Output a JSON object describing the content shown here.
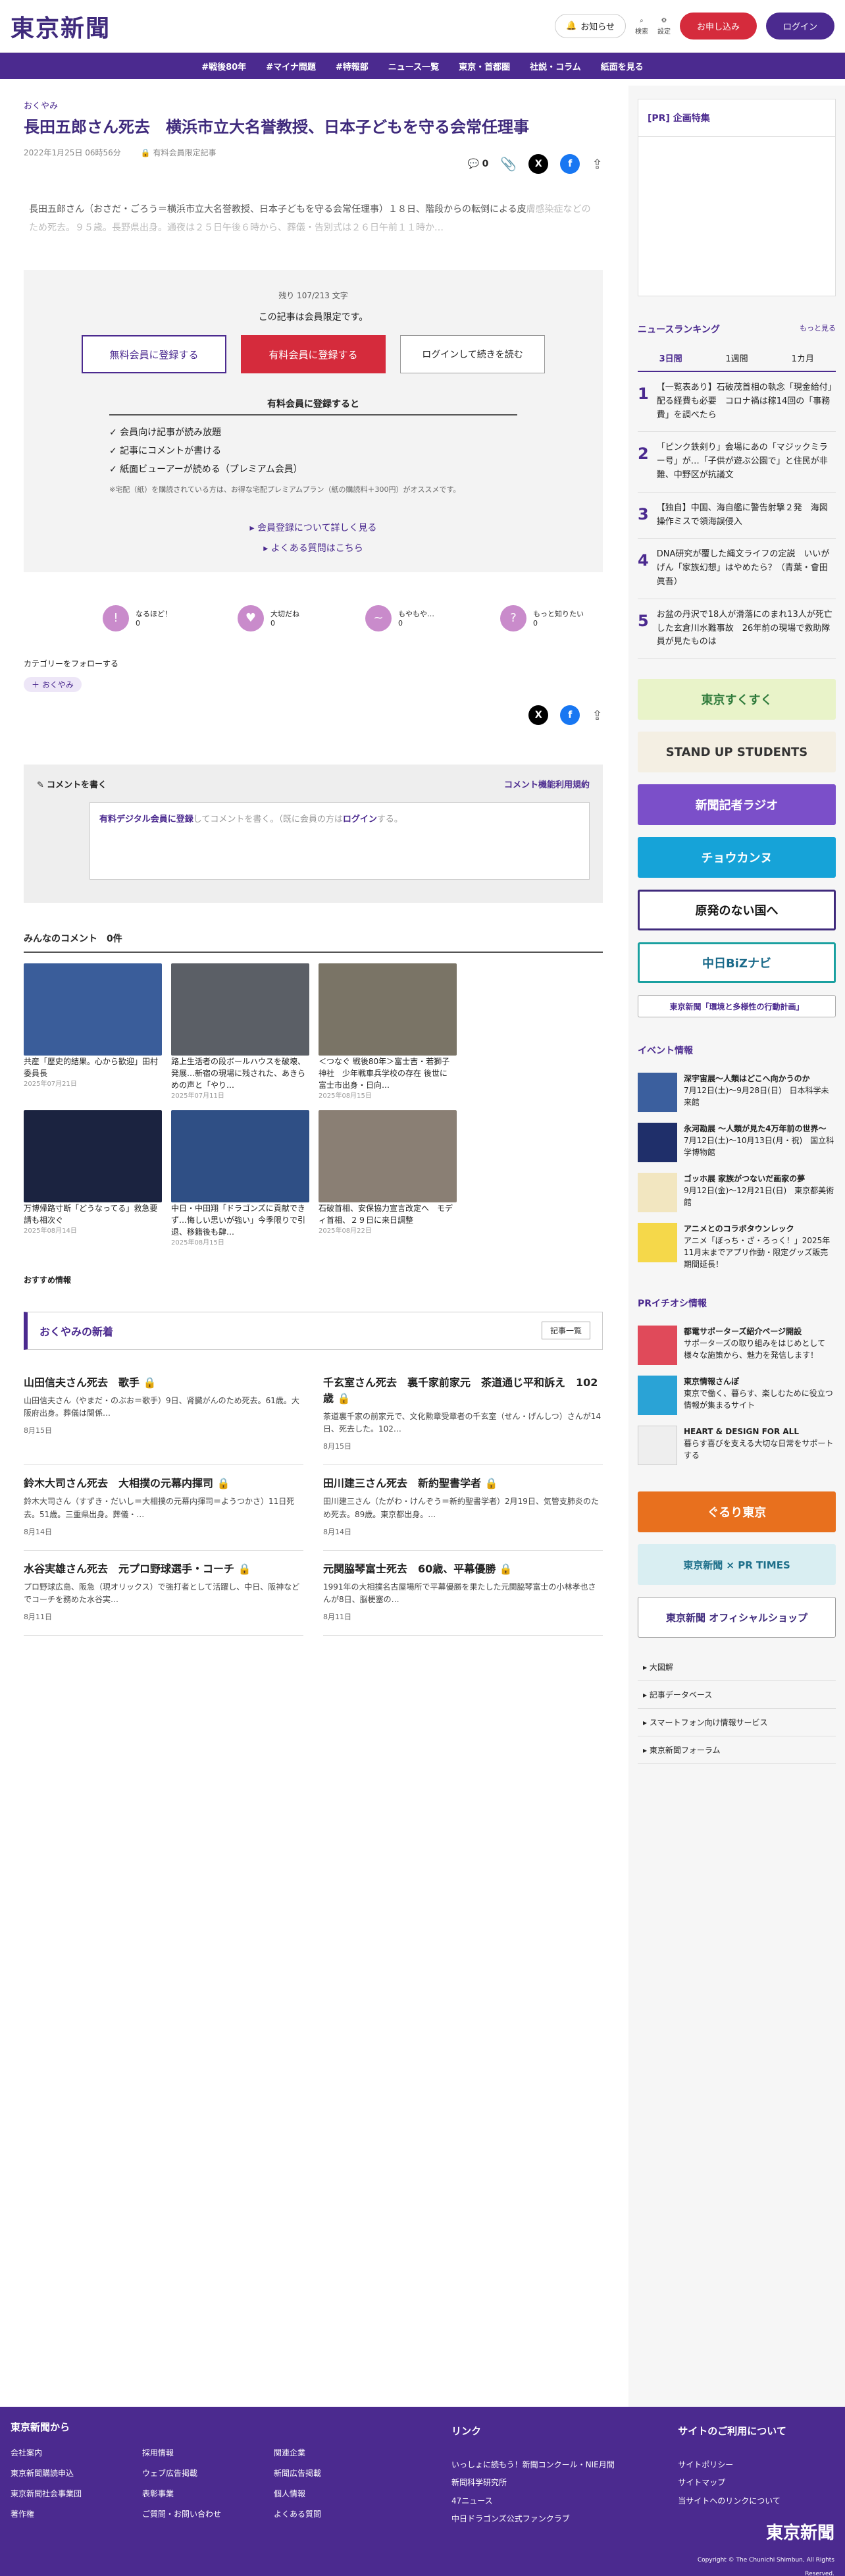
{
  "header": {
    "logo": "東京新聞",
    "notify": "お知らせ",
    "search": "検索",
    "settings": "設定",
    "register": "お申し込み",
    "login": "ログイン"
  },
  "nav": [
    "#戦後80年",
    "#マイナ問題",
    "#特報部",
    "ニュース一覧",
    "東京・首都圏",
    "社説・コラム",
    "紙面を見る"
  ],
  "article": {
    "category": "おくやみ",
    "title": "長田五郎さん死去　横浜市立大名誉教授、日本子どもを守る会常任理事",
    "date": "2022年1月25日 06時56分",
    "member_label": "有料会員限定記事",
    "comment_count": "0",
    "lead": "長田五郎さん（おさだ・ごろう＝横浜市立大名誉教授、日本子どもを守る会常任理事）１８日、階段からの転倒による皮",
    "lead_faded": "膚感染症などのため死去。９５歳。長野県出身。通夜は２５日午後６時から、葬儀・告別式は２６日午前１１時か…"
  },
  "paywall": {
    "remain": "残り 107/213 文字",
    "limited": "この記事は会員限定です。",
    "free_btn": "無料会員に登録する",
    "paid_btn": "有料会員に登録する",
    "login_btn": "ログインして続きを読む",
    "perk_head": "有料会員に登録すると",
    "perks": [
      "✓ 会員向け記事が読み放題",
      "✓ 記事にコメントが書ける",
      "✓ 紙面ビューアーが読める（プレミアム会員）"
    ],
    "note": "※宅配（紙）を購読されている方は、お得な宅配プレミアムプラン（紙の購読料＋300円）がオススメです。",
    "link1": "会員登録について詳しく見る",
    "link2": "よくある質問はこちら"
  },
  "reactions": [
    {
      "label": "なるほど！",
      "count": "0"
    },
    {
      "label": "大切だね",
      "count": "0"
    },
    {
      "label": "もやもや…",
      "count": "0"
    },
    {
      "label": "もっと知りたい",
      "count": "0"
    }
  ],
  "follow": {
    "label": "カテゴリーをフォローする",
    "tag": "＋ おくやみ"
  },
  "comment": {
    "title": "コメントを書く",
    "rules": "コメント機能利用規約",
    "placeholder_a": "有料デジタル会員に登録",
    "placeholder_b": "してコメントを書く。（既に会員の方は",
    "placeholder_c": "ログイン",
    "placeholder_d": "する。"
  },
  "comments_header": "みんなのコメント　0件",
  "cards": [
    {
      "text": "共産「歴史的結果。心から歓迎」田村委員長",
      "date": "2025年07月21日"
    },
    {
      "text": "路上生活者の段ボールハウスを破壊、発展…新宿の現場に残された、あきらめの声と「やり…",
      "date": "2025年07月11日"
    },
    {
      "text": "＜つなぐ 戦後80年＞富士吉・若獅子神社　少年戦車兵学校の存在 後世に　富士市出身・日向…",
      "date": "2025年08月15日"
    },
    {
      "text": "万博帰路寸断「どうなってる」救急要請も相次ぐ",
      "date": "2025年08月14日"
    },
    {
      "text": "中日・中田翔「ドラゴンズに貢献できず…悔しい思いが強い」今季限りで引退、移籍後も肆…",
      "date": "2025年08月15日"
    },
    {
      "text": "石破首相、安保協力宣言改定へ　モディ首相、２９日に来日調整",
      "date": "2025年08月22日"
    }
  ],
  "sponsor": "おすすめ情報",
  "okuyami": {
    "title": "おくやみの新着",
    "more": "記事一覧",
    "items": [
      {
        "title": "山田信夫さん死去　歌手",
        "body": "山田信夫さん（やまだ・のぶお＝歌手）9日、肾臓がんのため死去。61歳。大阪府出身。葬儀は関係…",
        "date": "8月15日"
      },
      {
        "title": "千玄室さん死去　裏千家前家元　茶道通じ平和訴え　102歳",
        "body": "茶道裏千家の前家元で、文化勲章受章者の千玄室（せん・げんしつ）さんが14日、死去した。102…",
        "date": "8月15日"
      },
      {
        "title": "鈴木大司さん死去　大相撲の元幕内揮司",
        "body": "鈴木大司さん（すずき・だいし＝大相撲の元幕内揮司＝ようつかさ）11日死去。51歳。三重県出身。葬儀・…",
        "date": "8月14日"
      },
      {
        "title": "田川建三さん死去　新約聖書学者",
        "body": "田川建三さん（たがわ・けんぞう＝新約聖書学者）2月19日、気管支肺炎のため死去。89歳。東京都出身。…",
        "date": "8月14日"
      },
      {
        "title": "水谷実雄さん死去　元プロ野球選手・コーチ",
        "body": "プロ野球広島、阪急（現オリックス）で強打者として活躍し、中日、阪神などでコーチを務めた水谷実…",
        "date": "8月11日"
      },
      {
        "title": "元関脇琴富士死去　60歳、平幕優勝",
        "body": "1991年の大相撲名古屋場所で平幕優勝を果たした元関脇琴富士の小林孝也さんが8日、脳梗塞の…",
        "date": "8月11日"
      }
    ]
  },
  "side": {
    "pr": "[PR] 企画特集",
    "ranking": "ニュースランキング",
    "ranking_more": "もっと見る",
    "tabs": [
      "3日間",
      "1週間",
      "1カ月"
    ],
    "ranks": [
      {
        "n": "1",
        "t": "【一覧表あり】石破茂首相の執念「現金給付」配る経費も必要　コロナ禍は稼14回の「事務費」を調べたら"
      },
      {
        "n": "2",
        "t": "「ピンク鉄剣り」会場にあの「マジックミラー号」が…「子供が遊ぶ公園で」と住民が非難、中野区が抗議文"
      },
      {
        "n": "3",
        "t": "【独自】中国、海自艦に警告射撃２発　海図操作ミスで領海誤侵入"
      },
      {
        "n": "4",
        "t": "DNA研究が覆した縄文ライフの定説　いいがげん「家族幻想」はやめたら？（青葉・會田眞吾）"
      },
      {
        "n": "5",
        "t": "お盆の丹沢で18人が滑落にのまれ13人が死亡した玄倉川水難事故　26年前の現場で救助隊員が見たものは"
      }
    ],
    "banners": [
      "東京すくすく",
      "STAND UP STUDENTS",
      "新聞記者ラジオ",
      "チョウカンヌ",
      "原発のない国へ",
      "中日BiZナビ",
      "東京新聞「環境と多様性の行動計画」"
    ],
    "event_head": "イベント情報",
    "events": [
      {
        "t": "深宇宙展〜人類はどこへ向かうのか",
        "d": "7月12日(土)〜9月28日(日)　日本科学未来館"
      },
      {
        "t": "永河勘展 〜人類が見た4万年前の世界〜",
        "d": "7月12日(土)〜10月13日(月・祝)　国立科学博物館"
      },
      {
        "t": "ゴッホ展 家族がつないだ画家の夢",
        "d": "9月12日(金)〜12月21日(日)　東京都美術館"
      },
      {
        "t": "アニメとのコラボタウンレック",
        "d": "アニメ「ぼっち・ざ・ろっく！」2025年11月末までアプリ作動・限定グッズ販売期間延長！"
      }
    ],
    "pr_head": "PRイチオシ情報",
    "prs": [
      {
        "t": "都電サポーターズ紹介ページ開設",
        "d": "サポーターズの取り組みをはじめとして様々な施策から、魅力を発信します！"
      },
      {
        "t": "東京情報さんぽ",
        "d": "東京で働く、暮らす、楽しむために役立つ情報が集まるサイト"
      },
      {
        "t": "HEART & DESIGN FOR ALL",
        "d": "暮らす喜びを支える大切な日常をサポートする"
      }
    ],
    "shop_banners": [
      "ぐるり東京",
      "東京新聞 × PR TIMES",
      "東京新聞 オフィシャルショップ"
    ],
    "links": [
      "大図解",
      "記事データベース",
      "スマートフォン向け情報サービス",
      "東京新聞フォーラム"
    ]
  },
  "footer": {
    "c1": "東京新聞から",
    "c1items": [
      "会社案内",
      "採用情報",
      "関連企業",
      "東京新聞購読申込",
      "ウェブ広告掲載",
      "新聞広告掲載",
      "東京新聞社会事業団",
      "表彰事業",
      "個人情報",
      "著作権",
      "ご質問・お問い合わせ",
      "よくある質問"
    ],
    "c2": "リンク",
    "c2items": [
      "いっしょに読もう！新聞コンクール・NIE月間",
      "新聞科学研究所",
      "47ニュース",
      "中日ドラゴンズ公式ファンクラブ"
    ],
    "c3": "サイトのご利用について",
    "c3items": [
      "サイトポリシー",
      "サイトマップ",
      "当サイトへのリンクについて"
    ],
    "logo": "東京新聞",
    "copy": "Copyright © The Chunichi Shimbun, All Rights Reserved."
  },
  "colors": {
    "brand": "#4b2a8f",
    "red": "#d52b3c"
  }
}
